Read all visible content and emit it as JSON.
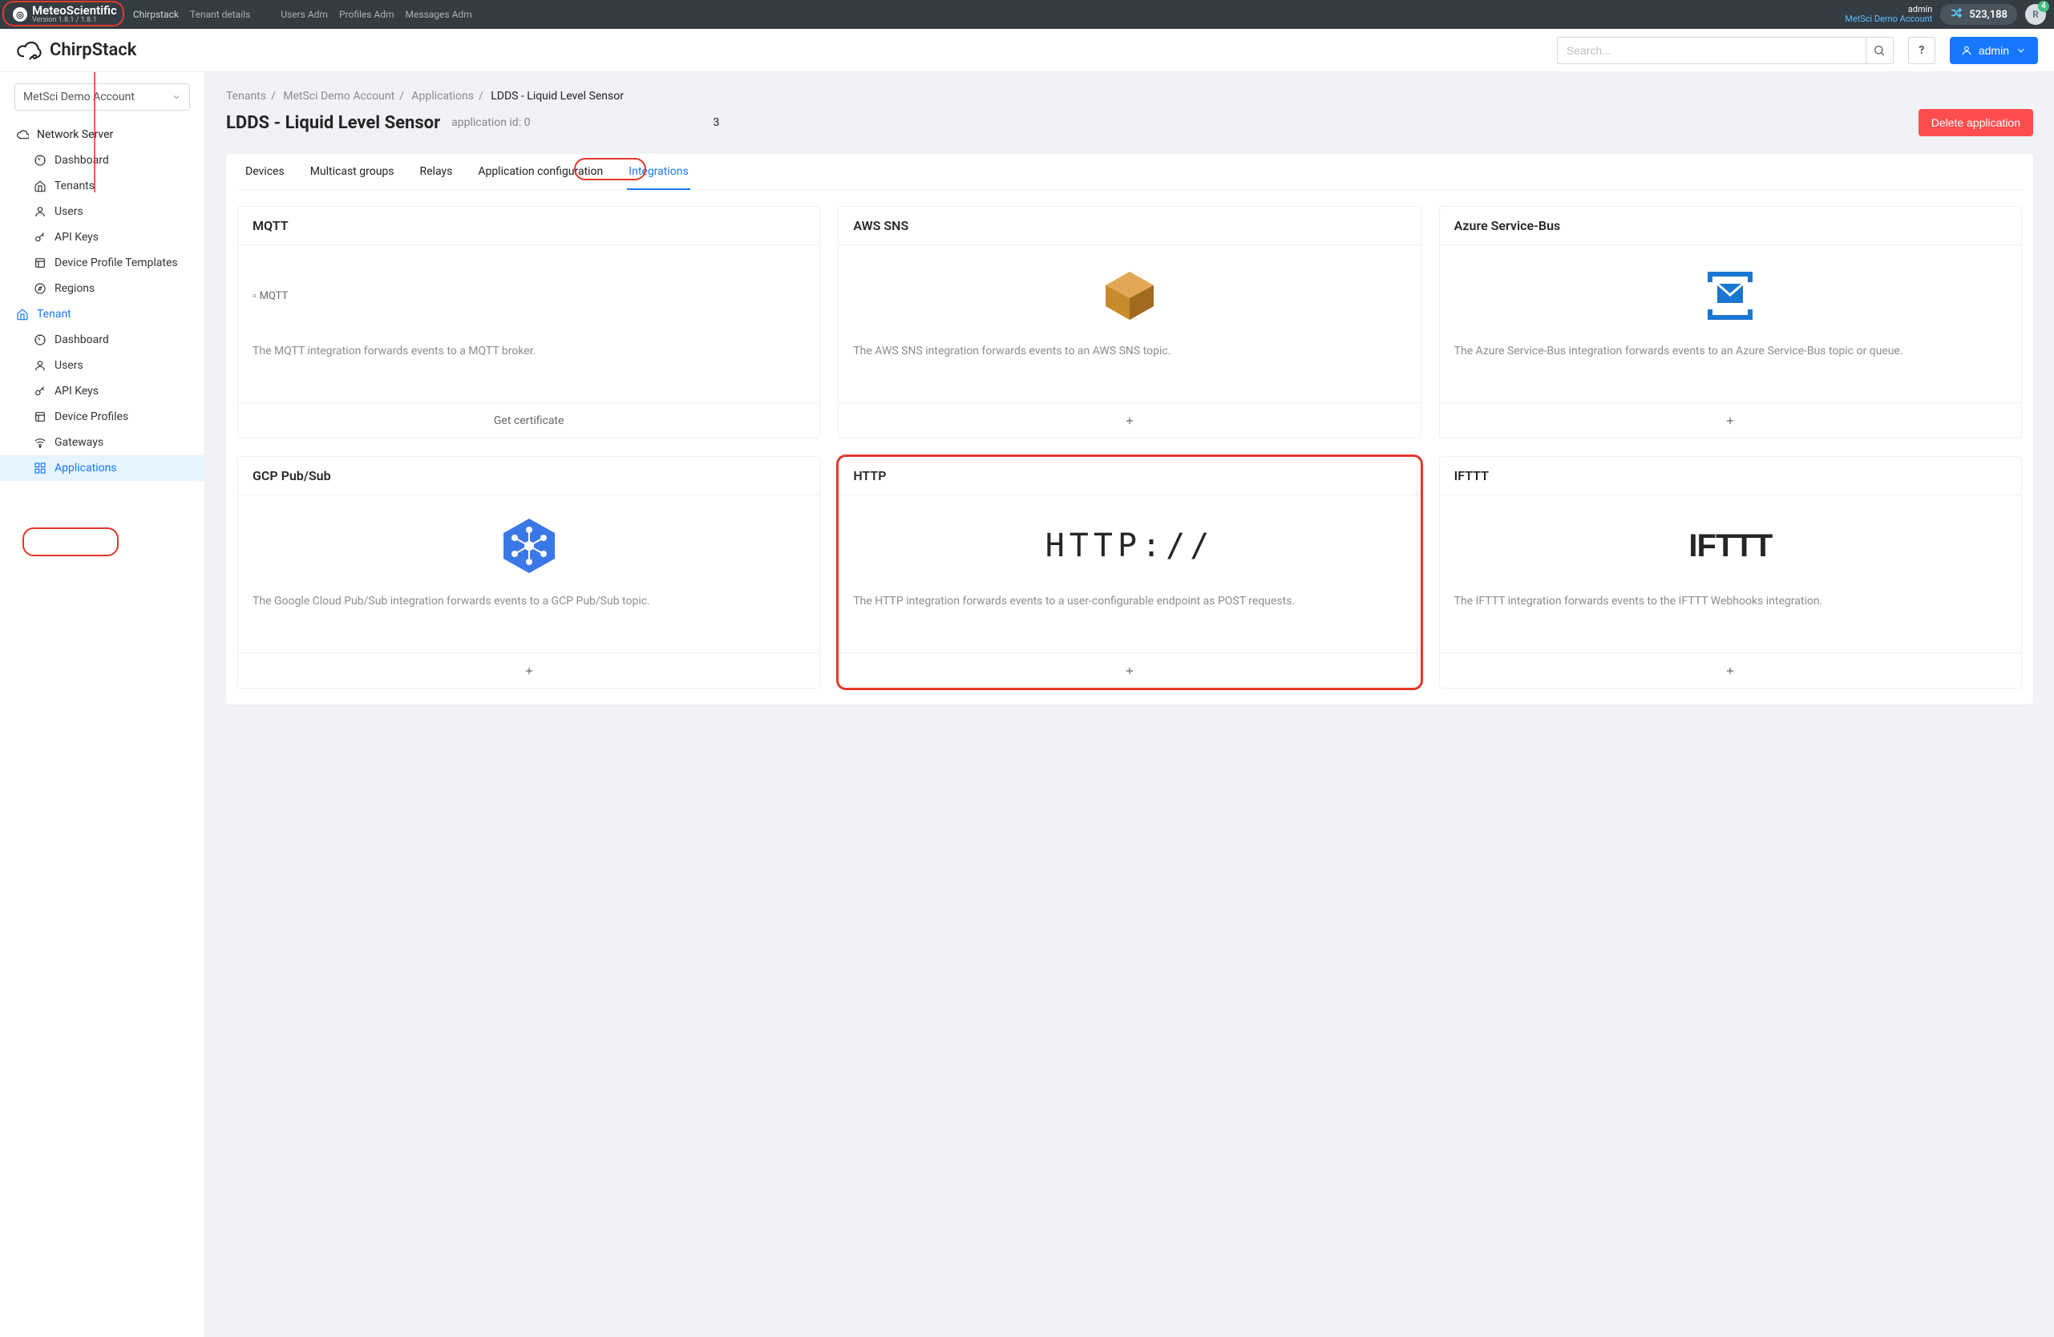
{
  "topbar": {
    "brand_name": "MeteoScientific",
    "brand_sub": "Version 1.8.1 / 1.8.1",
    "links": {
      "chirpstack": "Chirpstack",
      "tenant_details": "Tenant details",
      "users_adm": "Users Adm",
      "profiles_adm": "Profiles Adm",
      "messages_adm": "Messages Adm"
    },
    "role": "admin",
    "account": "MetSci Demo Account",
    "balance": "523,188",
    "avatar_badge": "4",
    "avatar_initial": "R"
  },
  "header": {
    "logo_text": "ChirpStack",
    "search_placeholder": "Search...",
    "help": "?",
    "admin_label": "admin"
  },
  "sidebar": {
    "tenant_selected": "MetSci Demo Account",
    "ns_label": "Network Server",
    "ns_items": [
      {
        "label": "Dashboard",
        "icon": "dashboard"
      },
      {
        "label": "Tenants",
        "icon": "home"
      },
      {
        "label": "Users",
        "icon": "user"
      },
      {
        "label": "API Keys",
        "icon": "key"
      },
      {
        "label": "Device Profile Templates",
        "icon": "template"
      },
      {
        "label": "Regions",
        "icon": "compass"
      }
    ],
    "tenant_label": "Tenant",
    "tenant_items": [
      {
        "label": "Dashboard",
        "icon": "dashboard"
      },
      {
        "label": "Users",
        "icon": "user"
      },
      {
        "label": "API Keys",
        "icon": "key"
      },
      {
        "label": "Device Profiles",
        "icon": "template"
      },
      {
        "label": "Gateways",
        "icon": "wifi"
      },
      {
        "label": "Applications",
        "icon": "apps",
        "active": true
      }
    ]
  },
  "breadcrumb": {
    "tenants": "Tenants",
    "tenant": "MetSci Demo Account",
    "apps": "Applications",
    "current": "LDDS - Liquid Level Sensor"
  },
  "page": {
    "title": "LDDS - Liquid Level Sensor",
    "appid_label": "application id: 0",
    "delete_label": "Delete application",
    "stray": "3"
  },
  "tabs": {
    "devices": "Devices",
    "mgroups": "Multicast groups",
    "relays": "Relays",
    "appcfg": "Application configuration",
    "integrations": "Integrations"
  },
  "cards": {
    "mqtt": {
      "title": "MQTT",
      "broken_alt": "MQTT",
      "desc": "The MQTT integration forwards events to a MQTT broker.",
      "action": "Get certificate"
    },
    "sns": {
      "title": "AWS SNS",
      "desc": "The AWS SNS integration forwards events to an AWS SNS topic."
    },
    "azure": {
      "title": "Azure Service-Bus",
      "desc": "The Azure Service-Bus integration forwards events to an Azure Service-Bus topic or queue."
    },
    "gcp": {
      "title": "GCP Pub/Sub",
      "desc": "The Google Cloud Pub/Sub integration forwards events to a GCP Pub/Sub topic."
    },
    "http": {
      "title": "HTTP",
      "logo": "HTTP://",
      "desc": "The HTTP integration forwards events to a user-configurable endpoint as POST requests."
    },
    "ifttt": {
      "title": "IFTTT",
      "logo": "IFTTT",
      "desc": "The IFTTT integration forwards events to the IFTTT Webhooks integration."
    }
  }
}
